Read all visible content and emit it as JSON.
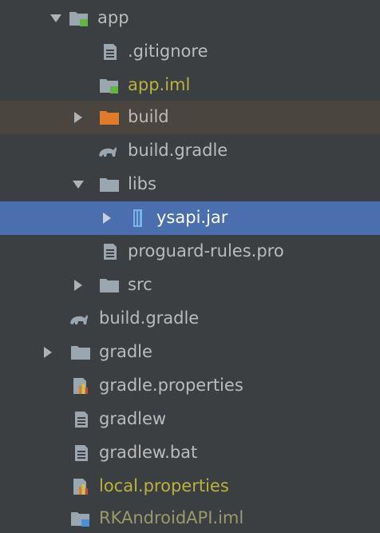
{
  "tree": {
    "rows": [
      {
        "id": "app",
        "label": "app",
        "icon": "module-folder-icon",
        "expanded": true
      },
      {
        "id": "gitignore",
        "label": ".gitignore",
        "icon": "text-file-icon"
      },
      {
        "id": "app-iml",
        "label": "app.iml",
        "icon": "module-file-icon"
      },
      {
        "id": "build-folder",
        "label": "build",
        "icon": "excluded-folder-icon",
        "expanded": false,
        "highlighted": true
      },
      {
        "id": "build-gradle-app",
        "label": "build.gradle",
        "icon": "gradle-icon"
      },
      {
        "id": "libs",
        "label": "libs",
        "icon": "folder-icon",
        "expanded": true
      },
      {
        "id": "ysapi-jar",
        "label": "ysapi.jar",
        "icon": "jar-icon",
        "expanded": false,
        "selected": true
      },
      {
        "id": "proguard",
        "label": "proguard-rules.pro",
        "icon": "text-file-icon"
      },
      {
        "id": "src",
        "label": "src",
        "icon": "folder-icon",
        "expanded": false
      },
      {
        "id": "build-gradle-root",
        "label": "build.gradle",
        "icon": "gradle-icon"
      },
      {
        "id": "gradle-folder",
        "label": "gradle",
        "icon": "folder-icon",
        "expanded": false
      },
      {
        "id": "gradle-properties",
        "label": "gradle.properties",
        "icon": "properties-file-icon"
      },
      {
        "id": "gradlew",
        "label": "gradlew",
        "icon": "text-file-icon"
      },
      {
        "id": "gradlew-bat",
        "label": "gradlew.bat",
        "icon": "text-file-icon"
      },
      {
        "id": "local-properties",
        "label": "local.properties",
        "icon": "properties-file-icon"
      },
      {
        "id": "rk-iml",
        "label": "RKAndroidAPI.iml",
        "icon": "module-file-icon"
      }
    ]
  },
  "colors": {
    "background": "#3c3f41",
    "selection": "#4b6eaf",
    "highlight": "#4a453e",
    "module_text": "#b8b33a"
  }
}
